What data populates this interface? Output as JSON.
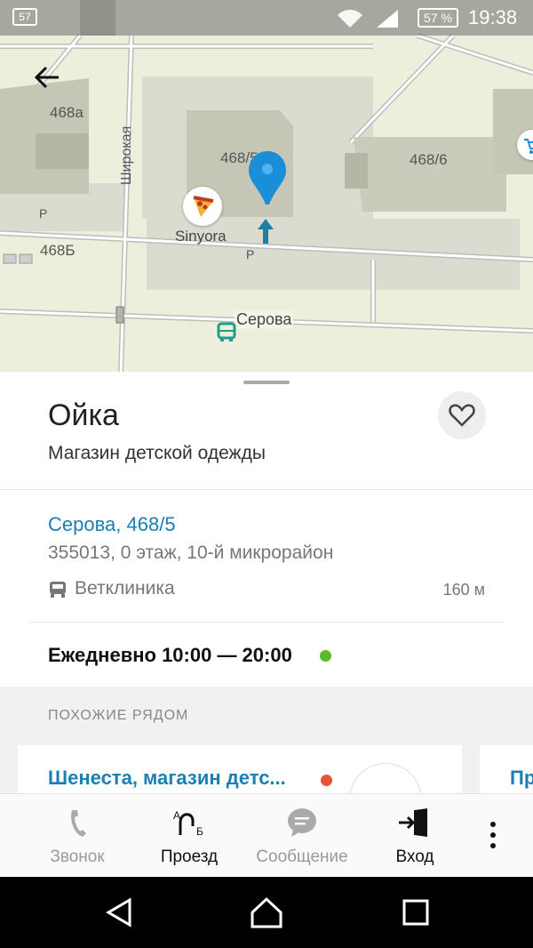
{
  "status_bar": {
    "notification_count": "57",
    "battery": "57 %",
    "time": "19:38"
  },
  "map": {
    "buildings": [
      "468а",
      "468/5",
      "468/6",
      "468Б"
    ],
    "parking_label": "P",
    "streets": {
      "vertical": "Широкая",
      "horizontal": "Серова"
    },
    "poi": {
      "name": "Sinyora",
      "icon": "pizza-icon"
    },
    "icons": {
      "back": "arrow-left-icon",
      "location_pin": "map-pin-icon",
      "bus_stop": "bus-icon",
      "shop": "cart-icon"
    }
  },
  "place": {
    "title": "Ойка",
    "category": "Магазин детской одежды",
    "address": "Серова, 468/5",
    "address_details": "355013, 0 этаж, 10-й микрорайон",
    "nearest_stop": {
      "name": "Ветклиника",
      "distance": "160 м"
    },
    "hours": "Ежедневно 10:00 — 20:00",
    "open_status_color": "#5bb82b"
  },
  "nearby": {
    "section_label": "ПОХОЖИЕ РЯДОМ",
    "items": [
      {
        "title": "Шенеста, магазин детс...",
        "status_color": "#e55533"
      },
      {
        "title": "Пр"
      }
    ]
  },
  "actions": [
    {
      "label": "Звонок",
      "icon": "phone-icon",
      "enabled": false
    },
    {
      "label": "Проезд",
      "icon": "route-icon",
      "enabled": true
    },
    {
      "label": "Сообщение",
      "icon": "message-icon",
      "enabled": false
    },
    {
      "label": "Вход",
      "icon": "login-icon",
      "enabled": true
    }
  ],
  "colors": {
    "accent": "#1a7fb5",
    "pin": "#1a8fd8"
  }
}
